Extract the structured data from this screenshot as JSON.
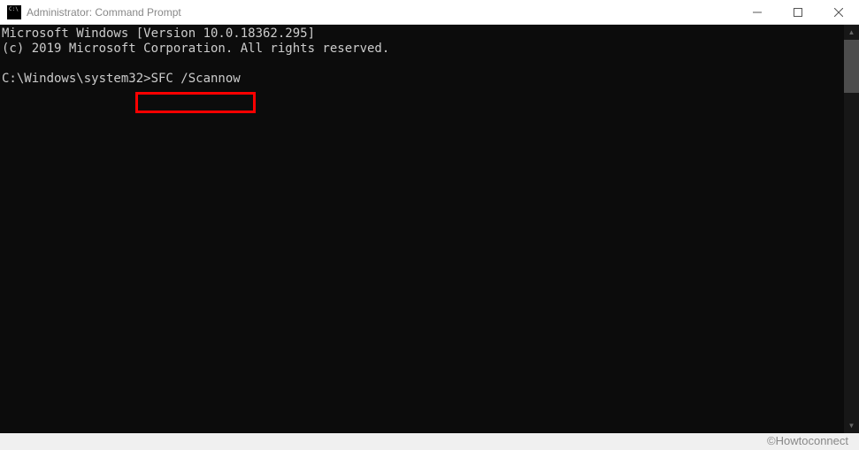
{
  "window": {
    "title": "Administrator: Command Prompt"
  },
  "console": {
    "line1": "Microsoft Windows [Version 10.0.18362.295]",
    "line2": "(c) 2019 Microsoft Corporation. All rights reserved.",
    "blank": "",
    "prompt_path": "C:\\Windows\\system32>",
    "command": "SFC /Scannow"
  },
  "watermark": "©Howtoconnect"
}
